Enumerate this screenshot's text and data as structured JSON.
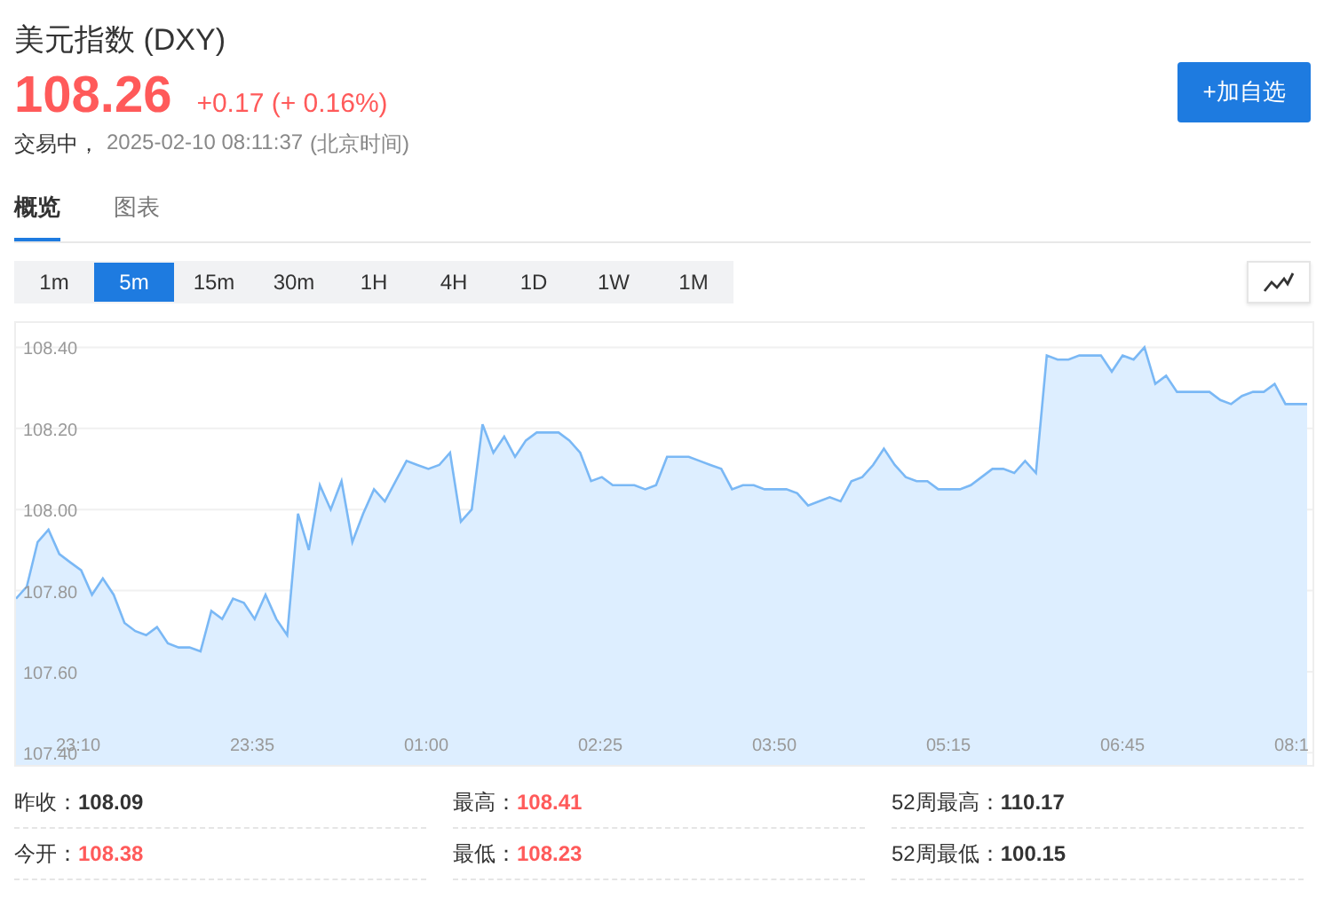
{
  "header": {
    "title": "美元指数 (DXY)",
    "price": "108.26",
    "change": "+0.17 (+ 0.16%)",
    "status": "交易中，",
    "timestamp": "2025-02-10 08:11:37",
    "timezone": "(北京时间)",
    "watch_button": "+加自选"
  },
  "tabs": [
    {
      "label": "概览",
      "selected": true
    },
    {
      "label": "图表",
      "selected": false
    }
  ],
  "periods": [
    {
      "label": "1m",
      "selected": false
    },
    {
      "label": "5m",
      "selected": true
    },
    {
      "label": "15m",
      "selected": false
    },
    {
      "label": "30m",
      "selected": false
    },
    {
      "label": "1H",
      "selected": false
    },
    {
      "label": "4H",
      "selected": false
    },
    {
      "label": "1D",
      "selected": false
    },
    {
      "label": "1W",
      "selected": false
    },
    {
      "label": "1M",
      "selected": false
    }
  ],
  "chart": {
    "x_axis_labels": [
      "23:10",
      "23:35",
      "01:00",
      "02:25",
      "03:50",
      "05:15",
      "06:45",
      "08:1"
    ],
    "chart_data": {
      "type": "area",
      "grid": true,
      "series": [
        {
          "color": "#7ab8f5",
          "values": [
            107.78,
            107.81,
            107.92,
            107.95,
            107.89,
            107.87,
            107.85,
            107.79,
            107.83,
            107.79,
            107.72,
            107.7,
            107.69,
            107.71,
            107.67,
            107.66,
            107.66,
            107.65,
            107.75,
            107.73,
            107.78,
            107.77,
            107.73,
            107.79,
            107.73,
            107.69,
            107.99,
            107.9,
            108.06,
            108.0,
            108.07,
            107.92,
            107.99,
            108.05,
            108.02,
            108.07,
            108.12,
            108.11,
            108.1,
            108.11,
            108.14,
            107.97,
            108.0,
            108.21,
            108.14,
            108.18,
            108.13,
            108.17,
            108.19,
            108.19,
            108.19,
            108.17,
            108.14,
            108.07,
            108.08,
            108.06,
            108.06,
            108.06,
            108.05,
            108.06,
            108.13,
            108.13,
            108.13,
            108.12,
            108.11,
            108.1,
            108.05,
            108.06,
            108.06,
            108.05,
            108.05,
            108.05,
            108.04,
            108.01,
            108.02,
            108.03,
            108.02,
            108.07,
            108.08,
            108.11,
            108.15,
            108.11,
            108.08,
            108.07,
            108.07,
            108.05,
            108.05,
            108.05,
            108.06,
            108.08,
            108.1,
            108.1,
            108.09,
            108.12,
            108.09,
            108.38,
            108.37,
            108.37,
            108.38,
            108.38,
            108.38,
            108.34,
            108.38,
            108.37,
            108.4,
            108.31,
            108.33,
            108.29,
            108.29,
            108.29,
            108.29,
            108.27,
            108.26,
            108.28,
            108.29,
            108.29,
            108.31,
            108.26,
            108.26,
            108.26
          ]
        }
      ],
      "ylim": [
        107.37,
        108.46
      ],
      "yticks": [
        {
          "value": 107.4,
          "label": "107.40"
        },
        {
          "value": 107.6,
          "label": "107.60"
        },
        {
          "value": 107.8,
          "label": "107.80"
        },
        {
          "value": 108.0,
          "label": "108.00"
        },
        {
          "value": 108.2,
          "label": "108.20"
        },
        {
          "value": 108.4,
          "label": "108.40"
        }
      ]
    }
  },
  "stats": [
    {
      "label": "昨收：",
      "value": "108.09",
      "color": "#333333"
    },
    {
      "label": "最高：",
      "value": "108.41",
      "color": "#ff5a5a"
    },
    {
      "label": "52周最高：",
      "value": "110.17",
      "color": "#333333"
    },
    {
      "label": "今开：",
      "value": "108.38",
      "color": "#ff5a5a"
    },
    {
      "label": "最低：",
      "value": "108.23",
      "color": "#ff5a5a"
    },
    {
      "label": "52周最低：",
      "value": "100.15",
      "color": "#333333"
    }
  ]
}
